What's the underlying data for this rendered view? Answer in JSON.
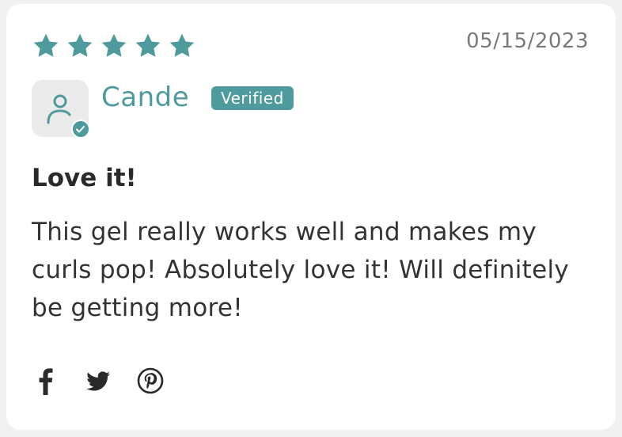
{
  "review": {
    "rating": 5,
    "rating_max": 5,
    "date": "05/15/2023",
    "author": "Cande",
    "verified_label": "Verified",
    "title": "Love it!",
    "body": "This gel really works well and makes my curls pop! Absolutely love it! Will definitely be getting more!"
  },
  "share": {
    "icons": [
      "facebook-icon",
      "twitter-icon",
      "pinterest-icon"
    ]
  },
  "colors": {
    "accent": "#4f9a9c",
    "text": "#333333",
    "muted": "#7a7a7a",
    "avatar_bg": "#ebebeb"
  }
}
